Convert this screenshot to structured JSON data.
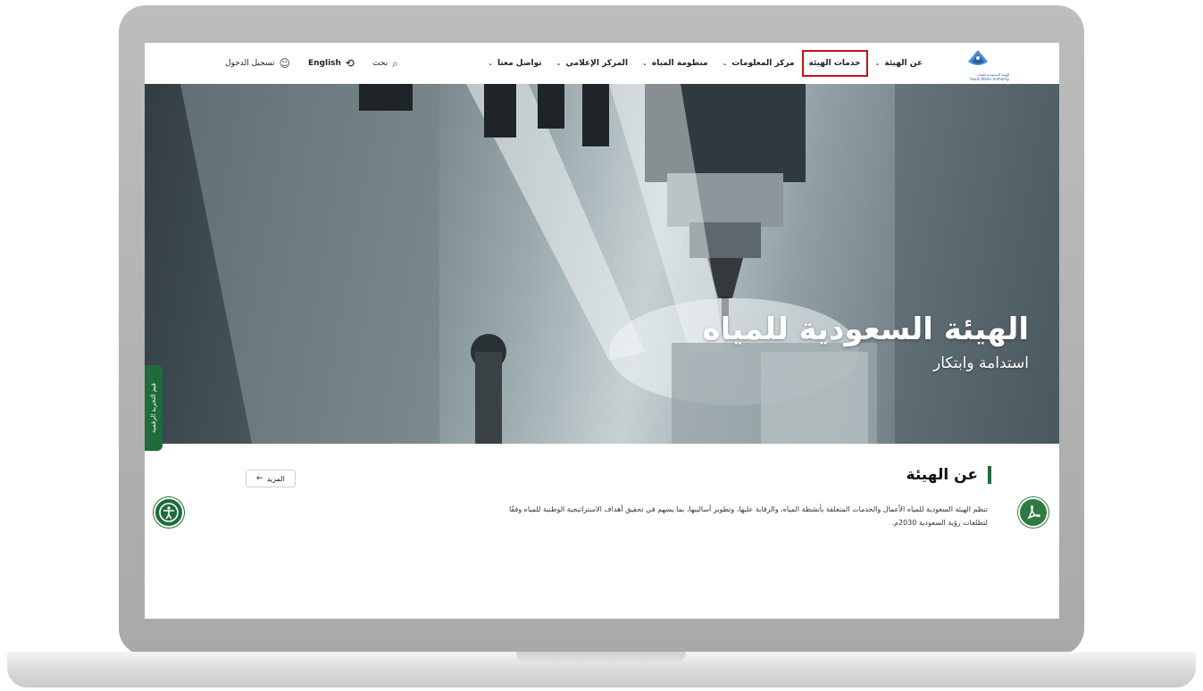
{
  "header": {
    "logo": {
      "name_ar": "الهيئة السعودية للمياه",
      "name_en": "Saudi Water Authority",
      "icon": "water-drop-logo-icon"
    },
    "nav": [
      {
        "label": "عن الهيئة",
        "has_dropdown": true,
        "active": false
      },
      {
        "label": "خدمات الهيئة",
        "has_dropdown": false,
        "active": true
      },
      {
        "label": "مركز المعلومات",
        "has_dropdown": true,
        "active": false
      },
      {
        "label": "منظومة المياه",
        "has_dropdown": true,
        "active": false
      },
      {
        "label": "المركز الإعلامي",
        "has_dropdown": true,
        "active": false
      },
      {
        "label": "تواصل معنا",
        "has_dropdown": true,
        "active": false
      }
    ],
    "tools": {
      "search_label": "بحث",
      "language_label": "English",
      "login_label": "تسجيل الدخول"
    }
  },
  "hero": {
    "title": "الهيئة السعودية للمياه",
    "subtitle": "استدامة وابتكار",
    "side_tab_label": "قيم التجربة الرقمية"
  },
  "about": {
    "title": "عن الهيئة",
    "description_line1": "تنظم الهيئة السعودية للمياه الأعمال والخدمات المتعلقة بأنشطة المياه، والرقابة عليها، وتطوير أساليبها، بما يسهم في تحقيق أهداف الاستراتيجية الوطنية للمياه وفقًا",
    "description_line2": "لتطلعات رؤية السعودية 2030م.",
    "more_label": "المزيد"
  },
  "colors": {
    "brand_green": "#1f6b3b",
    "active_outline": "#c1121f",
    "logo_blue": "#2c5f9e"
  }
}
